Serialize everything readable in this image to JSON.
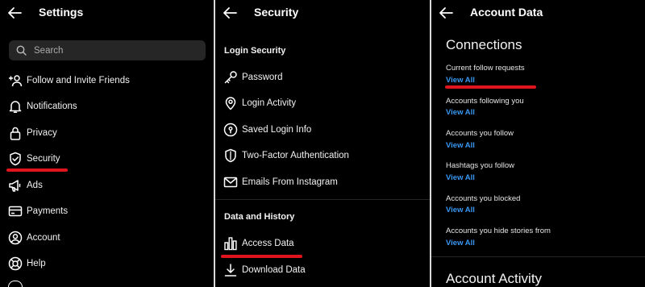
{
  "settings": {
    "title": "Settings",
    "search_placeholder": "Search",
    "items": [
      {
        "label": "Follow and Invite Friends",
        "icon": "add-person-icon"
      },
      {
        "label": "Notifications",
        "icon": "bell-icon"
      },
      {
        "label": "Privacy",
        "icon": "lock-icon"
      },
      {
        "label": "Security",
        "icon": "shield-icon"
      },
      {
        "label": "Ads",
        "icon": "megaphone-icon"
      },
      {
        "label": "Payments",
        "icon": "card-icon"
      },
      {
        "label": "Account",
        "icon": "person-circle-icon"
      },
      {
        "label": "Help",
        "icon": "lifebuoy-icon"
      }
    ]
  },
  "security": {
    "title": "Security",
    "login_section": "Login Security",
    "login_items": [
      {
        "label": "Password",
        "icon": "key-icon"
      },
      {
        "label": "Login Activity",
        "icon": "location-pin-icon"
      },
      {
        "label": "Saved Login Info",
        "icon": "keyhole-icon"
      },
      {
        "label": "Two-Factor Authentication",
        "icon": "shield-check-icon"
      },
      {
        "label": "Emails From Instagram",
        "icon": "mail-icon"
      }
    ],
    "data_section": "Data and History",
    "data_items": [
      {
        "label": "Access Data",
        "icon": "bar-chart-icon"
      },
      {
        "label": "Download Data",
        "icon": "download-icon"
      }
    ]
  },
  "account_data": {
    "title": "Account Data",
    "connections_heading": "Connections",
    "rows": [
      {
        "label": "Current follow requests",
        "link": "View All"
      },
      {
        "label": "Accounts following you",
        "link": "View All"
      },
      {
        "label": "Accounts you follow",
        "link": "View All"
      },
      {
        "label": "Hashtags you follow",
        "link": "View All"
      },
      {
        "label": "Accounts you blocked",
        "link": "View All"
      },
      {
        "label": "Accounts you hide stories from",
        "link": "View All"
      }
    ],
    "activity_heading": "Account Activity"
  },
  "colors": {
    "background": "#000000",
    "link": "#3897f0",
    "highlight_underline": "#e0141e",
    "search_bg": "#262626"
  }
}
